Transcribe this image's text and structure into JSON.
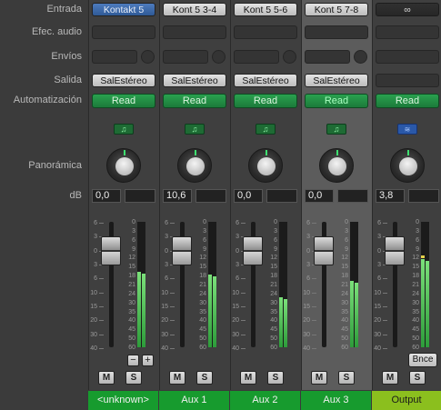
{
  "row_labels": {
    "input": "Entrada",
    "audio_fx": "Efec. audio",
    "sends": "Envíos",
    "output": "Salida",
    "automation": "Automatización",
    "pan": "Panorámica",
    "db": "dB"
  },
  "channels": [
    {
      "input": "Kontakt 5",
      "output": "SalEstéreo",
      "automation": "Read",
      "volume": "0,0",
      "name": "<unknown>",
      "meter_level": 0.6,
      "fader_level": 0.77
    },
    {
      "input": "Kont 5 3-4",
      "output": "SalEstéreo",
      "automation": "Read",
      "volume": "10,6",
      "name": "Aux 1",
      "meter_level": 0.58,
      "fader_level": 0.77
    },
    {
      "input": "Kont 5 5-6",
      "output": "SalEstéreo",
      "automation": "Read",
      "volume": "0,0",
      "name": "Aux 2",
      "meter_level": 0.4,
      "fader_level": 0.77
    },
    {
      "input": "Kont 5 7-8",
      "output": "SalEstéreo",
      "automation": "Read",
      "volume": "0,0",
      "name": "Aux 3",
      "meter_level": 0.53,
      "fader_level": 0.77,
      "selected": true
    },
    {
      "input": "link-icon",
      "automation": "Read",
      "volume": "3,8",
      "name": "Output",
      "meter_level": 0.7,
      "fader_level": 0.77
    }
  ],
  "scale_ticks": [
    "0",
    "3",
    "6",
    "9",
    "12",
    "15",
    "18",
    "21",
    "24",
    "30",
    "35",
    "40",
    "45",
    "50",
    "60"
  ],
  "fader_ticks": [
    "6",
    "3",
    "0",
    "3",
    "6",
    "10",
    "15",
    "20",
    "30",
    "40"
  ],
  "buttons": {
    "mute": "M",
    "solo": "S",
    "minus": "−",
    "plus": "+",
    "bounce": "Bnce"
  },
  "icons": {
    "instrument": "♫",
    "stereo_out": "≋",
    "link": "∞"
  }
}
